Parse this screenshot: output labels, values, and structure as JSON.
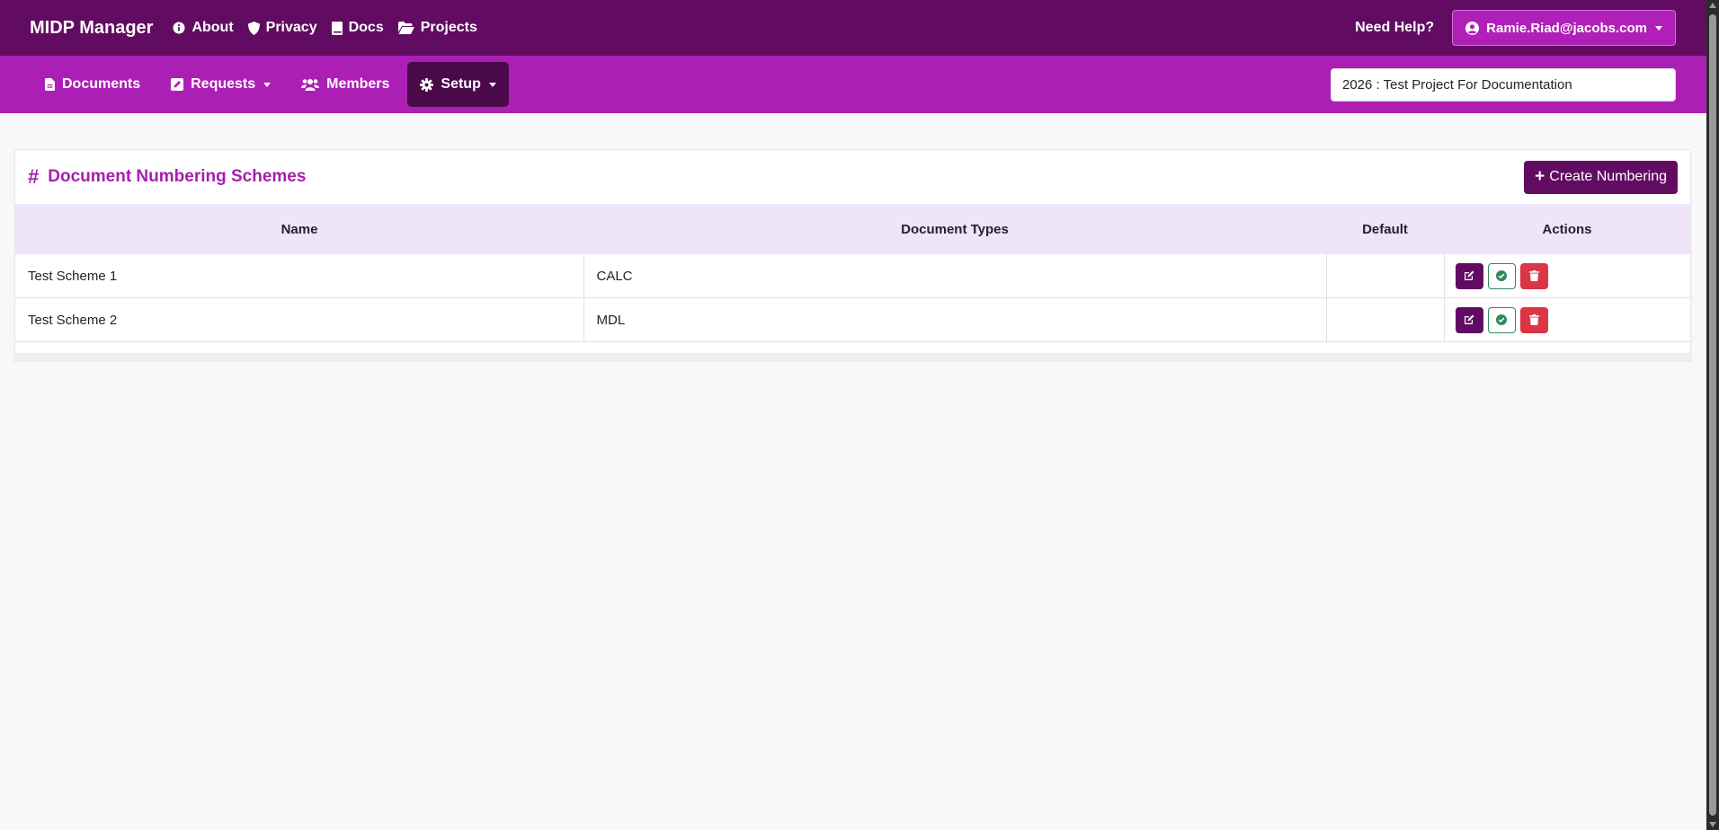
{
  "header": {
    "brand": "MIDP Manager",
    "links": [
      {
        "label": "About",
        "icon": "info-icon"
      },
      {
        "label": "Privacy",
        "icon": "shield-icon"
      },
      {
        "label": "Docs",
        "icon": "book-icon"
      },
      {
        "label": "Projects",
        "icon": "folder-open-icon"
      }
    ],
    "help_label": "Need Help?",
    "user_email": "Ramie.Riad@jacobs.com"
  },
  "subnav": {
    "items": [
      {
        "label": "Documents",
        "icon": "file-icon"
      },
      {
        "label": "Requests",
        "icon": "edit-square-icon",
        "dropdown": true
      },
      {
        "label": "Members",
        "icon": "users-icon"
      },
      {
        "label": "Setup",
        "icon": "gear-icon",
        "dropdown": true,
        "active": true
      }
    ],
    "project_selected": "2026 : Test Project For Documentation"
  },
  "card": {
    "title_icon": "#",
    "title": "Document Numbering Schemes",
    "create_button": "Create Numbering",
    "columns": [
      "Name",
      "Document Types",
      "Default",
      "Actions"
    ],
    "rows": [
      {
        "name": "Test Scheme 1",
        "document_types": "CALC",
        "default": ""
      },
      {
        "name": "Test Scheme 2",
        "document_types": "MDL",
        "default": ""
      }
    ]
  },
  "colors": {
    "topbar": "#620b62",
    "subbar": "#ac1fb4",
    "accent_title": "#a51fae",
    "table_header": "#efe5fb",
    "edit_button": "#620b62",
    "default_button_border": "#2e8b57",
    "delete_button": "#dc3545"
  }
}
